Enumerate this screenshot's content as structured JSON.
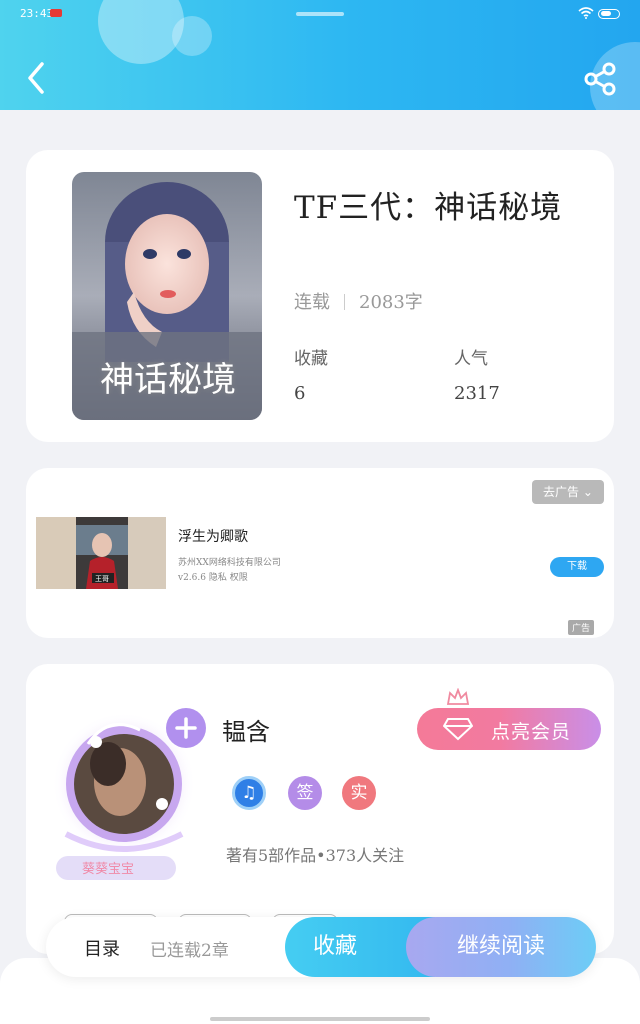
{
  "status_bar": {
    "time": "23:43"
  },
  "book": {
    "title": "TF三代：神话秘境",
    "status": "连载",
    "word_count": "2083字",
    "cover_text": "神话秘境",
    "favorites_label": "收藏",
    "favorites_value": "6",
    "popularity_label": "人气",
    "popularity_value": "2317"
  },
  "ad": {
    "close_label": "去广告",
    "title": "浮生为卿歌",
    "company": "苏州XX网络科技有限公司",
    "version": "v2.6.6  隐私  权限",
    "download_label": "下载",
    "ad_label": "广告",
    "thumb_caption": "王哥"
  },
  "author": {
    "name": "韫含",
    "vip_label": "点亮会员",
    "badge_sign": "签",
    "badge_real": "实",
    "badge_music": "♫",
    "stats": "著有5部作品•373人关注",
    "avatar_caption": "葵葵宝宝"
  },
  "bottom_bar": {
    "toc_label": "目录",
    "toc_status": "已连载2章",
    "collect_label": "收藏",
    "read_label": "继续阅读"
  },
  "colors": {
    "header_start": "#4fd3ee",
    "header_end": "#23a6ef",
    "vip_start": "#f47a98",
    "vip_end": "#c98fe8",
    "collect": "#3ec4f0",
    "read_start": "#a8a8f0",
    "read_end": "#6ccdf6"
  },
  "icons": {
    "back": "chevron-left-icon",
    "share": "share-icon",
    "plus": "plus-icon",
    "crown": "crown-icon",
    "diamond": "diamond-icon"
  }
}
